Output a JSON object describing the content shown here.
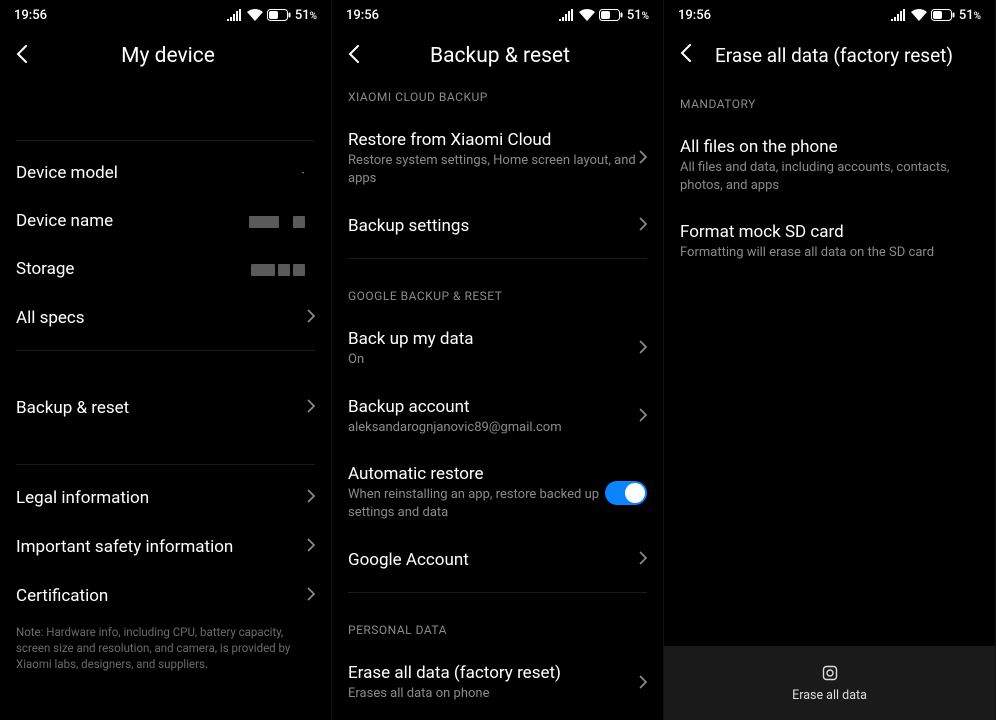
{
  "status": {
    "time": "19:56",
    "battery_pct": "51",
    "battery_suffix": "%"
  },
  "screen1": {
    "title": "My device",
    "items": {
      "device_model": "Device model",
      "device_name": "Device name",
      "storage": "Storage",
      "all_specs": "All specs",
      "backup_reset": "Backup & reset",
      "legal": "Legal information",
      "safety": "Important safety information",
      "cert": "Certification"
    },
    "note": "Note: Hardware info, including CPU, battery capacity, screen size and resolution, and camera, is provided by Xiaomi labs, designers, and suppliers."
  },
  "screen2": {
    "title": "Backup & reset",
    "section_xiaomi": "XIAOMI CLOUD BACKUP",
    "restore_cloud_label": "Restore from Xiaomi Cloud",
    "restore_cloud_sub": "Restore system settings, Home screen layout, and apps",
    "backup_settings": "Backup settings",
    "section_google": "GOOGLE BACKUP & RESET",
    "backup_data_label": "Back up my data",
    "backup_data_sub": "On",
    "backup_account_label": "Backup account",
    "backup_account_sub": "aleksandarognjanovic89@gmail.com",
    "auto_restore_label": "Automatic restore",
    "auto_restore_sub": "When reinstalling an app, restore backed up settings and data",
    "google_account": "Google Account",
    "section_personal": "PERSONAL DATA",
    "erase_label": "Erase all data (factory reset)",
    "erase_sub": "Erases all data on phone"
  },
  "screen3": {
    "title": "Erase all data (factory reset)",
    "section_mandatory": "MANDATORY",
    "files_label": "All files on the phone",
    "files_sub": "All files and data, including accounts, contacts, photos, and apps",
    "format_label": "Format mock SD card",
    "format_sub": "Formatting will erase all data on the SD card",
    "erase_btn": "Erase all data"
  }
}
